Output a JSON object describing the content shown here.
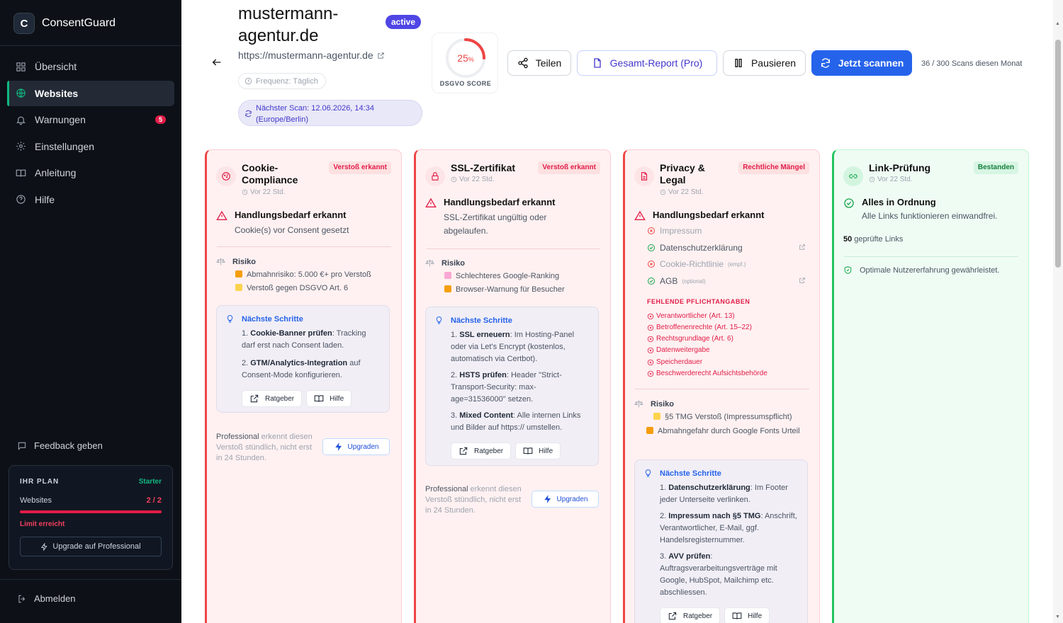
{
  "app": {
    "name": "ConsentGuard",
    "logo_letter": "C"
  },
  "nav": [
    {
      "label": "Übersicht",
      "icon": "grid-icon"
    },
    {
      "label": "Websites",
      "icon": "globe-icon",
      "active": true
    },
    {
      "label": "Warnungen",
      "icon": "bell-icon",
      "badge": "5"
    },
    {
      "label": "Einstellungen",
      "icon": "gear-icon"
    },
    {
      "label": "Anleitung",
      "icon": "book-icon"
    },
    {
      "label": "Hilfe",
      "icon": "help-icon"
    }
  ],
  "feedback_label": "Feedback geben",
  "plan": {
    "heading": "IHR PLAN",
    "name": "Starter",
    "websites_label": "Websites",
    "websites_value": "2 / 2",
    "usage_fraction": 1.0,
    "limit_text": "Limit erreicht",
    "upgrade_label": "Upgrade auf Professional"
  },
  "logout_label": "Abmelden",
  "site": {
    "title": "mustermann-agentur.de",
    "status": "active",
    "url": "https://mustermann-agentur.de",
    "frequency": "Frequenz: Täglich",
    "next_scan": "Nächster Scan: 12.06.2026, 14:34 (Europe/Berlin)"
  },
  "score": {
    "value": "25",
    "unit": "%",
    "fraction": 0.25,
    "label": "DSGVO SCORE"
  },
  "actions": {
    "share": "Teilen",
    "report": "Gesamt-Report (Pro)",
    "pause": "Pausieren",
    "scan": "Jetzt scannen",
    "quota": "36 / 300 Scans diesen Monat"
  },
  "colors": {
    "accent": "#2563eb",
    "danger": "#ef4444",
    "success": "#22c55e",
    "brand_green": "#10b981"
  },
  "cards": {
    "cookie": {
      "title": "Cookie-Compliance",
      "title_l1": "Cookie-",
      "title_l2": "Compliance",
      "time": "Vor 22 Std.",
      "badge": "Verstoß erkannt",
      "alert_title": "Handlungsbedarf erkannt",
      "alert_desc": "Cookie(s) vor Consent gesetzt",
      "risk_label": "Risiko",
      "risks": [
        "Abmahnrisiko: 5.000 €+ pro Verstoß",
        "Verstoß gegen DSGVO Art. 6"
      ],
      "steps_label": "Nächste Schritte",
      "steps": [
        {
          "n": "1.",
          "b": "Cookie-Banner prüfen",
          "t": ": Tracking darf erst nach Consent laden."
        },
        {
          "n": "2.",
          "b": "GTM/Analytics-Integration",
          "t": " auf Consent-Mode konfigurieren."
        }
      ],
      "btn_guide": "Ratgeber",
      "btn_help": "Hilfe",
      "pro_a": "Professional",
      "pro_b": " erkennt diesen Verstoß stündlich, nicht erst in 24 Stunden.",
      "upgrade": "Upgraden"
    },
    "ssl": {
      "title": "SSL-Zertifikat",
      "time": "Vor 22 Std.",
      "badge": "Verstoß erkannt",
      "alert_title": "Handlungsbedarf erkannt",
      "alert_desc": "SSL-Zertifikat ungültig oder abgelaufen.",
      "risk_label": "Risiko",
      "risks": [
        "Schlechteres Google-Ranking",
        "Browser-Warnung für Besucher"
      ],
      "steps_label": "Nächste Schritte",
      "steps": [
        {
          "n": "1.",
          "b": "SSL erneuern",
          "t": ": Im Hosting-Panel oder via Let's Encrypt (kostenlos, automatisch via Certbot)."
        },
        {
          "n": "2.",
          "b": "HSTS prüfen",
          "t": ": Header \"Strict-Transport-Security: max-age=31536000\" setzen."
        },
        {
          "n": "3.",
          "b": "Mixed Content",
          "t": ": Alle internen Links und Bilder auf https:// umstellen."
        }
      ],
      "btn_guide": "Ratgeber",
      "btn_help": "Hilfe",
      "pro_a": "Professional",
      "pro_b": " erkennt diesen Verstoß stündlich, nicht erst in 24 Stunden.",
      "upgrade": "Upgraden"
    },
    "privacy": {
      "title_l1": "Privacy &",
      "title_l2": "Legal",
      "time": "Vor 22 Std.",
      "badge": "Rechtliche Mängel",
      "alert_title": "Handlungsbedarf erkannt",
      "checks": [
        {
          "label": "Impressum",
          "ok": false,
          "tag": ""
        },
        {
          "label": "Datenschutzerklärung",
          "ok": true,
          "tag": ""
        },
        {
          "label": "Cookie-Richtlinie",
          "ok": false,
          "tag": "(empf.)"
        },
        {
          "label": "AGB",
          "ok": true,
          "tag": "(optional)"
        }
      ],
      "missing_label": "FEHLENDE PFLICHTANGABEN",
      "missing": [
        "Verantwortlicher (Art. 13)",
        "Betroffenenrechte (Art. 15–22)",
        "Rechtsgrundlage (Art. 6)",
        "Datenweitergabe",
        "Speicherdauer",
        "Beschwerderecht Aufsichtsbehörde"
      ],
      "risk_label": "Risiko",
      "risks": [
        "§5 TMG Verstoß (Impressumspflicht)",
        "Abmahngefahr durch Google Fonts Urteil"
      ],
      "steps_label": "Nächste Schritte",
      "steps": [
        {
          "n": "1.",
          "b": "Datenschutzerklärung",
          "t": ": Im Footer jeder Unterseite verlinken."
        },
        {
          "n": "2.",
          "b": "Impressum nach §5 TMG",
          "t": ": Anschrift, Verantwortlicher, E-Mail, ggf. Handelsregisternummer."
        },
        {
          "n": "3.",
          "b": "AVV prüfen",
          "t": ": Auftragsverarbeitungsverträge mit Google, HubSpot, Mailchimp etc. abschliessen."
        }
      ],
      "btn_guide": "Ratgeber",
      "btn_help": "Hilfe"
    },
    "links": {
      "title": "Link-Prüfung",
      "time": "Vor 22 Std.",
      "badge": "Bestanden",
      "alert_title": "Alles in Ordnung",
      "alert_desc": "Alle Links funktionieren einwandfrei.",
      "count": "50",
      "count_label": " geprüfte Links",
      "note": "Optimale Nutzererfahrung gewährleistet."
    }
  }
}
